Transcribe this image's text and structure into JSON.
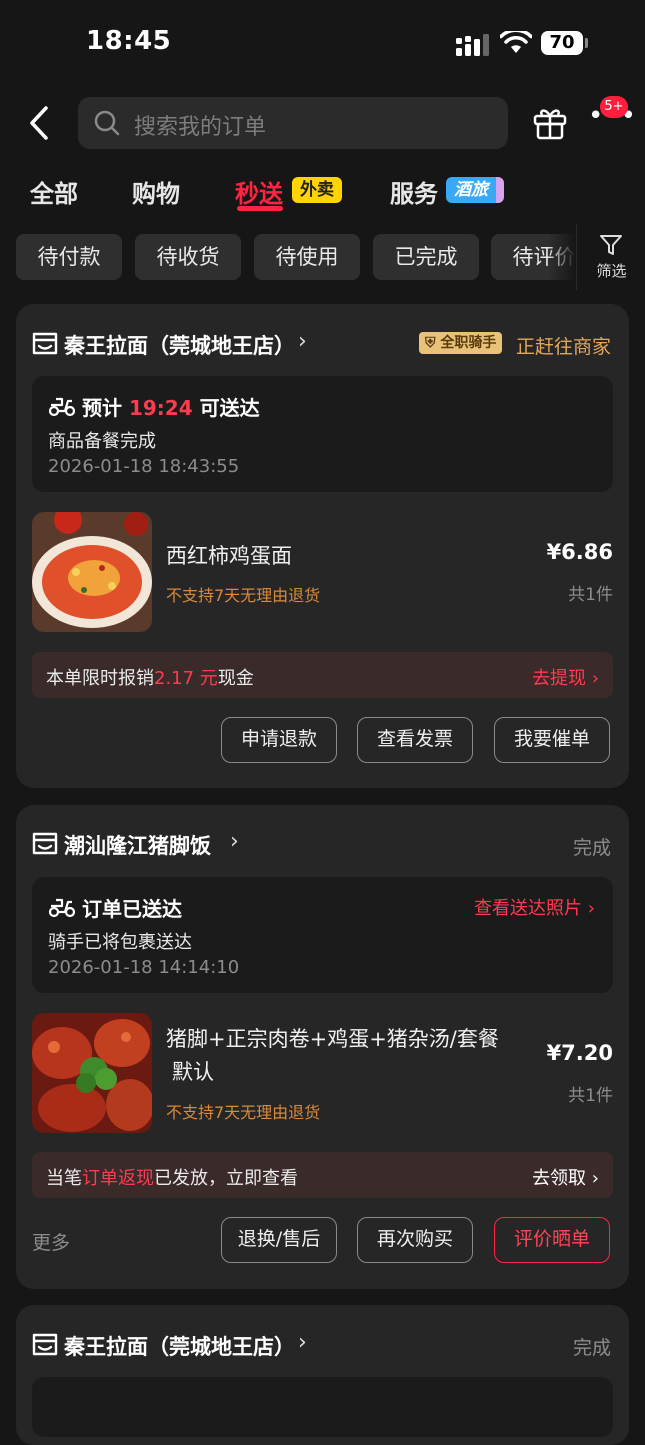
{
  "status_bar": {
    "time": "18:45",
    "battery": "70"
  },
  "header": {
    "search_placeholder": "搜索我的订单",
    "notification_badge": "5+"
  },
  "tabs": [
    {
      "label": "全部"
    },
    {
      "label": "购物"
    },
    {
      "label": "秒送",
      "tag": "外卖",
      "active": true
    },
    {
      "label": "服务",
      "tag": "酒旅"
    }
  ],
  "filters": {
    "chips": [
      "待付款",
      "待收货",
      "待使用",
      "已完成",
      "待评价"
    ],
    "button_label": "筛选"
  },
  "orders": [
    {
      "store": "秦王拉面（莞城地王店）",
      "rider_tag": "全职骑手",
      "status": "正赶往商家",
      "delivery": {
        "prefix": "预计",
        "eta": "19:24",
        "suffix": "可送达",
        "detail": "商品备餐完成",
        "timestamp": "2026-01-18 18:43:55"
      },
      "product": {
        "name": "西红柿鸡蛋面",
        "note": "不支持7天无理由退货",
        "price": "¥6.86",
        "qty": "共1件"
      },
      "promo": {
        "prefix": "本单限时报销",
        "amount": "2.17 元",
        "suffix": "现金",
        "link": "去提现"
      },
      "buttons": [
        "申请退款",
        "查看发票",
        "我要催单"
      ]
    },
    {
      "store": "潮汕隆江猪脚饭",
      "status": "完成",
      "delivery": {
        "title": "订单已送达",
        "link": "查看送达照片",
        "detail": "骑手已将包裹送达",
        "timestamp": "2026-01-18 14:14:10"
      },
      "product": {
        "name_line1": "猪脚+正宗肉卷+鸡蛋+猪杂汤/套餐",
        "name_line2": "默认",
        "note": "不支持7天无理由退货",
        "price": "¥7.20",
        "qty": "共1件"
      },
      "promo": {
        "prefix": "当笔",
        "highlight": "订单返现",
        "suffix": "已发放，立即查看",
        "link": "去领取"
      },
      "more": "更多",
      "buttons": [
        "退换/售后",
        "再次购买",
        "评价晒单"
      ]
    },
    {
      "store": "秦王拉面（莞城地王店）",
      "status": "完成"
    }
  ],
  "colors": {
    "accent": "#ff2442",
    "background": "#161616",
    "card": "#262626"
  }
}
